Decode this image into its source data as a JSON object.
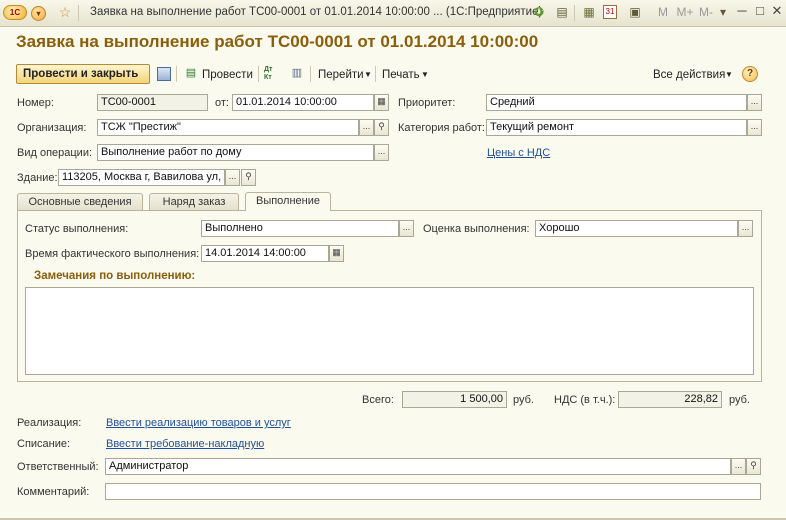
{
  "window": {
    "title": "Заявка на выполнение работ ТС00-0001 от 01.01.2014 10:00:00 ... (1С:Предприятие)",
    "controls": {
      "m": "M",
      "m_plus": "M+",
      "m_minus": "M-"
    }
  },
  "document": {
    "title": "Заявка на выполнение работ ТС00-0001 от 01.01.2014 10:00:00"
  },
  "toolbar": {
    "post_close": "Провести и закрыть",
    "post": "Провести",
    "dt_kt": "Дт Кт",
    "goto": "Перейти",
    "print": "Печать",
    "all_actions": "Все действия",
    "help": "?"
  },
  "fields": {
    "number": {
      "label": "Номер:",
      "value": "ТС00-0001"
    },
    "date": {
      "label": "от:",
      "value": "01.01.2014 10:00:00"
    },
    "priority": {
      "label": "Приоритет:",
      "value": "Средний"
    },
    "organization": {
      "label": "Организация:",
      "value": "ТСЖ \"Престиж\""
    },
    "work_category": {
      "label": "Категория работ:",
      "value": "Текущий ремонт"
    },
    "operation_type": {
      "label": "Вид операции:",
      "value": "Выполнение работ по дому"
    },
    "prices_vat_link": "Цены с НДС",
    "building": {
      "label": "Здание:",
      "value": "113205, Москва г, Вавилова ул,"
    }
  },
  "tabs": [
    {
      "label": "Основные сведения",
      "active": false
    },
    {
      "label": "Наряд заказ",
      "active": false
    },
    {
      "label": "Выполнение",
      "active": true
    }
  ],
  "execution": {
    "status": {
      "label": "Статус выполнения:",
      "value": "Выполнено"
    },
    "rating": {
      "label": "Оценка выполнения:",
      "value": "Хорошо"
    },
    "actual_time": {
      "label": "Время фактического выполнения:",
      "value": "14.01.2014 14:00:00"
    },
    "remarks_title": "Замечания по выполнению:",
    "remarks": ""
  },
  "totals": {
    "total_label": "Всего:",
    "total_value": "1 500,00",
    "currency": "руб.",
    "vat_label": "НДС (в т.ч.):",
    "vat_value": "228,82",
    "vat_currency": "руб."
  },
  "footer": {
    "realization": {
      "label": "Реализация:",
      "link": "Ввести реализацию товаров и услуг"
    },
    "writeoff": {
      "label": "Списание:",
      "link": "Ввести требование-накладную"
    },
    "responsible": {
      "label": "Ответственный:",
      "value": "Администратор"
    },
    "comment": {
      "label": "Комментарий:",
      "value": ""
    }
  },
  "icons": {
    "app_logo": "1c-logo-icon",
    "menu": "chevron-down-icon",
    "favorite": "star-icon",
    "calendar": "calendar-icon",
    "search": "magnifier-icon",
    "pick": "ellipsis-icon"
  }
}
